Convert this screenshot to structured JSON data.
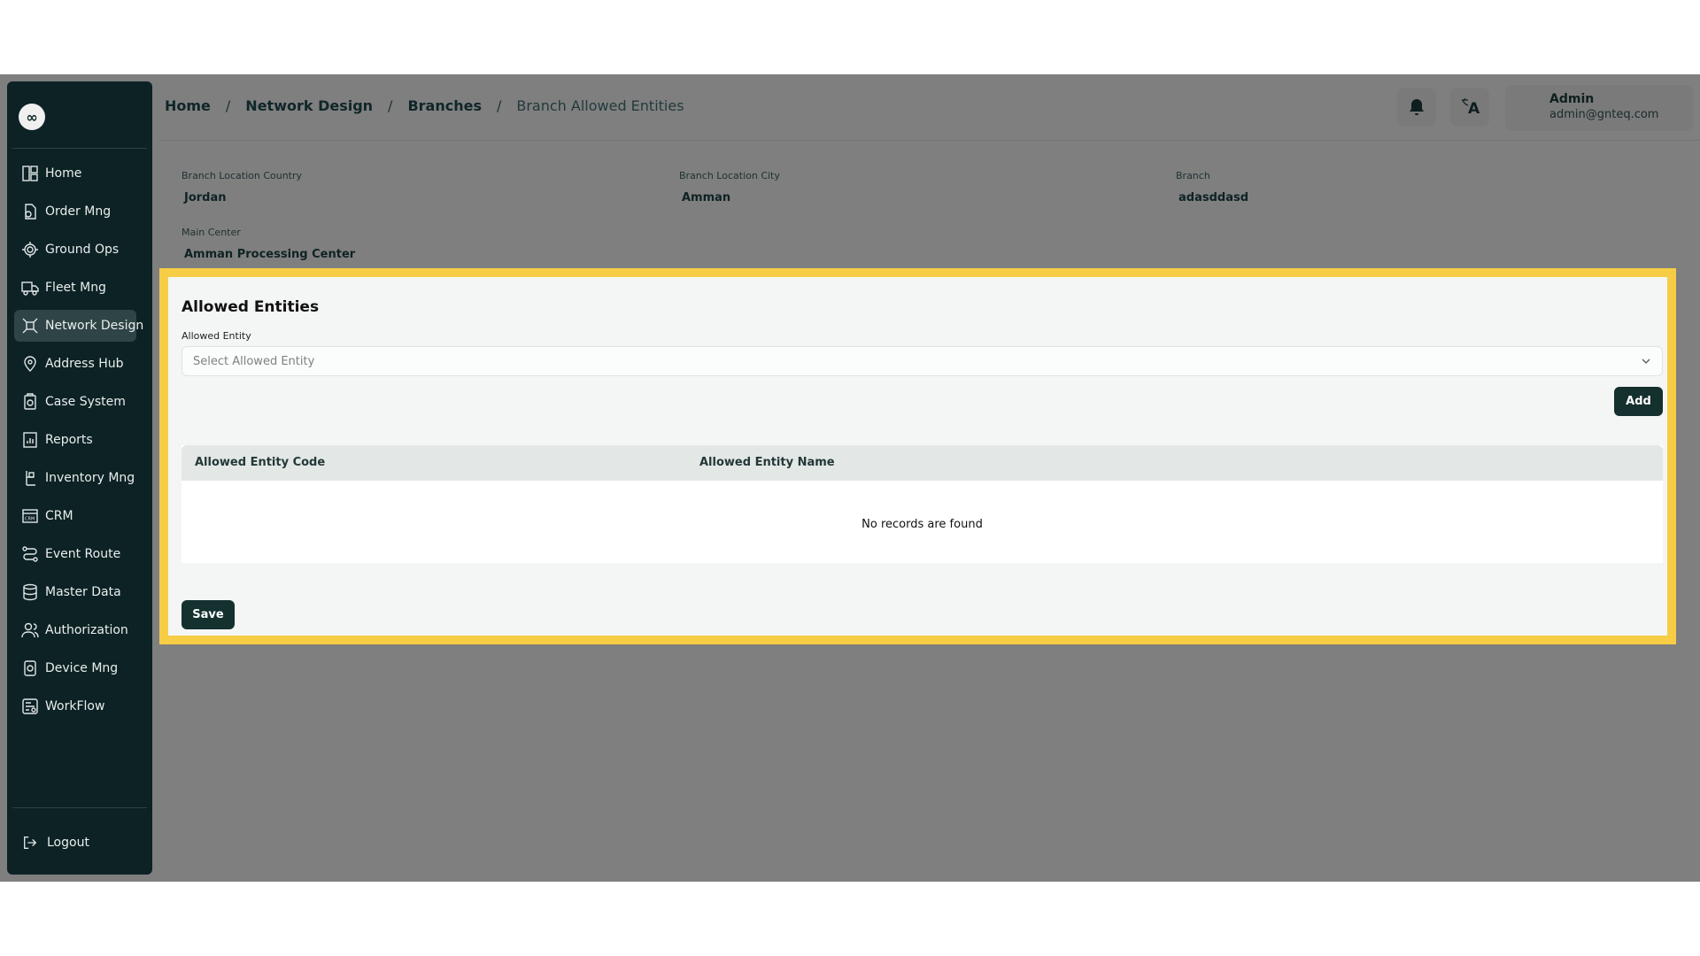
{
  "sidebar": {
    "logo_glyph": "∞",
    "items": [
      {
        "label": "Home",
        "icon": "home-icon"
      },
      {
        "label": "Order Mng",
        "icon": "order-icon"
      },
      {
        "label": "Ground Ops",
        "icon": "ground-ops-icon"
      },
      {
        "label": "Fleet Mng",
        "icon": "truck-icon"
      },
      {
        "label": "Network Design",
        "icon": "network-icon",
        "active": true
      },
      {
        "label": "Address Hub",
        "icon": "location-icon"
      },
      {
        "label": "Case System",
        "icon": "case-icon"
      },
      {
        "label": "Reports",
        "icon": "reports-icon"
      },
      {
        "label": "Inventory Mng",
        "icon": "inventory-icon"
      },
      {
        "label": "CRM",
        "icon": "crm-icon"
      },
      {
        "label": "Event Route",
        "icon": "route-icon"
      },
      {
        "label": "Master Data",
        "icon": "database-icon"
      },
      {
        "label": "Authorization",
        "icon": "users-icon"
      },
      {
        "label": "Device Mng",
        "icon": "device-icon"
      },
      {
        "label": "WorkFlow",
        "icon": "workflow-icon"
      }
    ],
    "logout_label": "Logout"
  },
  "breadcrumb": {
    "items": [
      "Home",
      "Network Design",
      "Branches"
    ],
    "separator": "/",
    "current": "Branch Allowed Entities"
  },
  "header": {
    "language_glyph": "A",
    "user_name": "Admin",
    "user_email": "admin@gnteq.com"
  },
  "info": {
    "country_label": "Branch Location Country",
    "country_value": "Jordan",
    "city_label": "Branch Location City",
    "city_value": "Amman",
    "branch_label": "Branch",
    "branch_value": "adasddasd",
    "center_label": "Main Center",
    "center_value": "Amman Processing Center"
  },
  "panel": {
    "title": "Allowed Entities",
    "entity_label": "Allowed Entity",
    "entity_placeholder": "Select Allowed Entity",
    "add_label": "Add",
    "columns": [
      "Allowed Entity Code",
      "Allowed Entity Name"
    ],
    "empty_message": "No records are found",
    "save_label": "Save"
  },
  "colors": {
    "sidebar_bg": "#0d2224",
    "primary_button": "#14302f",
    "highlight_frame": "#f7cd46",
    "overlay": "#7f7f7f"
  }
}
